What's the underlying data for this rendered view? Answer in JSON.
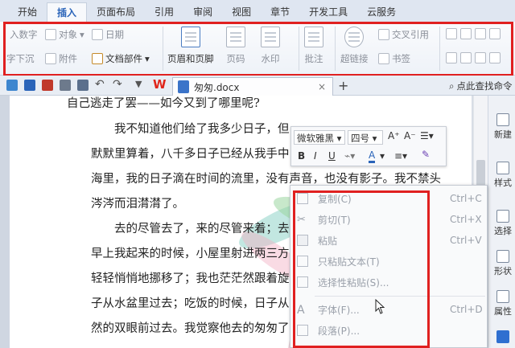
{
  "tabs": [
    "开始",
    "插入",
    "页面布局",
    "引用",
    "审阅",
    "视图",
    "章节",
    "开发工具",
    "云服务"
  ],
  "active_tab": "插入",
  "ribbon": {
    "insert_number": "入数字",
    "object": "对象",
    "date": "日期",
    "text_wrap": "字下沉",
    "attachment": "附件",
    "doc_parts": "文档部件",
    "header_footer": "页眉和页脚",
    "page_number": "页码",
    "watermark": "水印",
    "annotation": "批注",
    "hyperlink": "超链接",
    "cross_ref": "交叉引用",
    "bookmark": "书签"
  },
  "document_tab": {
    "title": "匆匆.docx",
    "close": "×"
  },
  "search_label": "点此查找命令",
  "document_lines": [
    "自己逃走了罢——如今又到了哪里呢?",
    "我不知道他们给了我多少日子，但",
    "默默里算着，八千多日子已经从我手中",
    "海里，我的日子滴在时间的流里，没有声音，也没有影子。我不禁头",
    "涔涔而泪潸潸了。",
    "去的尽管去了，来的尽管来着；去",
    "早上我起来的时候，小屋里射进两三方",
    "轻轻悄悄地挪移了；我也茫茫然跟着旋",
    "子从水盆里过去；吃饭的时候，日子从",
    "然的双眼前过去。我觉察他去的匆匆了"
  ],
  "mini_toolbar": {
    "font": "微软雅黑",
    "size": "四号",
    "bold": "B",
    "italic": "I",
    "underline": "U"
  },
  "context_menu": [
    {
      "label": "复制(C)",
      "shortcut": "Ctrl+C"
    },
    {
      "label": "剪切(T)",
      "shortcut": "Ctrl+X"
    },
    {
      "label": "粘贴",
      "shortcut": "Ctrl+V"
    },
    {
      "label": "只粘贴文本(T)",
      "shortcut": ""
    },
    {
      "label": "选择性粘贴(S)...",
      "shortcut": ""
    },
    {
      "label": "字体(F)...",
      "shortcut": "Ctrl+D"
    },
    {
      "label": "段落(P)...",
      "shortcut": ""
    }
  ],
  "right_pane": [
    "新建",
    "样式",
    "选择",
    "形状",
    "属性"
  ],
  "colors": {
    "highlight_red": "#e02020",
    "accent_blue": "#2a64b9",
    "wps_red": "#e0261b"
  }
}
